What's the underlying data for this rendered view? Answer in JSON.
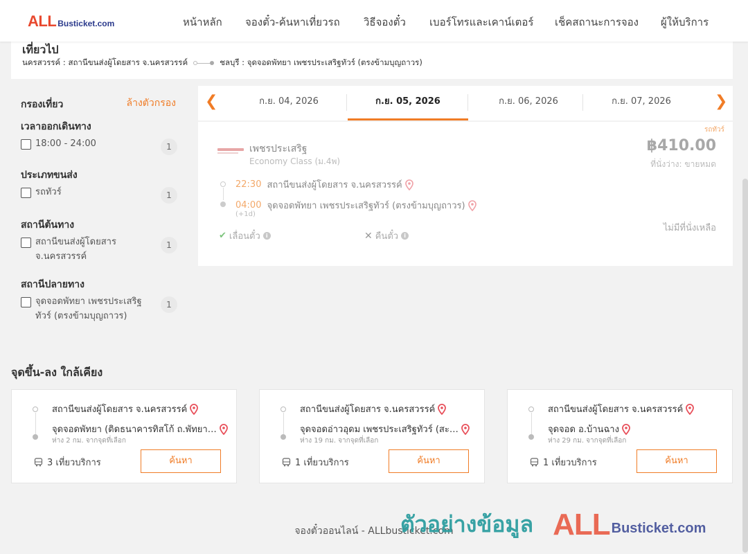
{
  "header": {
    "logo_all": "ALL",
    "logo_rest": "Busticket.com",
    "nav": [
      "หน้าหลัก",
      "จองตั๋ว-ค้นหาเที่ยวรถ",
      "วิธีจองตั๋ว",
      "เบอร์โทรและเคาน์เตอร์",
      "เช็คสถานะการจอง",
      "ผู้ให้บริการ"
    ]
  },
  "trip": {
    "title": "เที่ยวไป",
    "origin": "นครสวรรค์ : สถานีขนส่งผู้โดยสาร จ.นครสวรรค์",
    "destination": "ชลบุรี : จุดจอดพัทยา เพชรประเสริฐทัวร์ (ตรงข้ามบุญถาวร)"
  },
  "filters": {
    "title": "กรองเที่ยว",
    "clear": "ล้างตัวกรอง",
    "groups": [
      {
        "title": "เวลาออกเดินทาง",
        "option": "18:00 - 24:00",
        "count": "1"
      },
      {
        "title": "ประเภทขนส่ง",
        "option": "รถทัวร์",
        "count": "1"
      },
      {
        "title": "สถานีต้นทาง",
        "option": "สถานีขนส่งผู้โดยสาร จ.นครสวรรค์",
        "count": "1"
      },
      {
        "title": "สถานีปลายทาง",
        "option": "จุดจอดพัทยา เพชรประเสริฐทัวร์ (ตรงข้ามบุญถาวร)",
        "count": "1"
      }
    ]
  },
  "dates": [
    "ก.ย. 04, 2026",
    "ก.ย. 05, 2026",
    "ก.ย. 06, 2026",
    "ก.ย. 07, 2026"
  ],
  "active_date_index": 1,
  "result": {
    "tag": "รถทัวร์",
    "operator": "เพชรประเสริฐ",
    "class": "Economy Class (ม.4พ)",
    "price": "฿410.00",
    "seats": "ที่นั่งว่าง: ขายหมด",
    "depart_time": "22:30",
    "depart_station": "สถานีขนส่งผู้โดยสาร จ.นครสวรรค์",
    "arrive_time": "04:00",
    "arrive_station": "จุดจอดพัทยา เพชรประเสริฐทัวร์ (ตรงข้ามบุญถาวร)",
    "next_day": "(+1d)",
    "reschedule": "เลื่อนตั๋ว",
    "refund": "คืนตั๋ว",
    "no_seats": "ไม่มีที่นั่งเหลือ"
  },
  "nearby": {
    "title": "จุดขึ้น-ลง ใกล้เคียง",
    "button_label": "ค้นหา",
    "cards": [
      {
        "from": "สถานีขนส่งผู้โดยสาร จ.นครสวรรค์",
        "to": "จุดจอดพัทยา (ติดธนาคารทิสโก้ ถ.พัทยา…",
        "distance": "ห่าง 2 กม. จากจุดที่เลือก",
        "trips": "3 เที่ยวบริการ"
      },
      {
        "from": "สถานีขนส่งผู้โดยสาร จ.นครสวรรค์",
        "to": "จุดจอดอ่าวอุดม เพชรประเสริฐทัวร์ (สะ…",
        "distance": "ห่าง 19 กม. จากจุดที่เลือก",
        "trips": "1 เที่ยวบริการ"
      },
      {
        "from": "สถานีขนส่งผู้โดยสาร จ.นครสวรรค์",
        "to": "จุดจอด อ.บ้านฉาง",
        "distance": "ห่าง 29 กม. จากจุดที่เลือก",
        "trips": "1 เที่ยวบริการ"
      }
    ]
  },
  "footer": "จองตั๋วออนไลน์ - ALLbusticket.com",
  "watermark": {
    "text": "ตัวอย่างข้อมูล",
    "all": "ALL",
    "rest": "Busticket.com"
  },
  "colors": {
    "accent": "#f07c26",
    "brand_red": "#e8492f",
    "brand_blue": "#2b3a8c",
    "pin": "#e8505b",
    "watermark_teal": "#2f9ea0"
  }
}
